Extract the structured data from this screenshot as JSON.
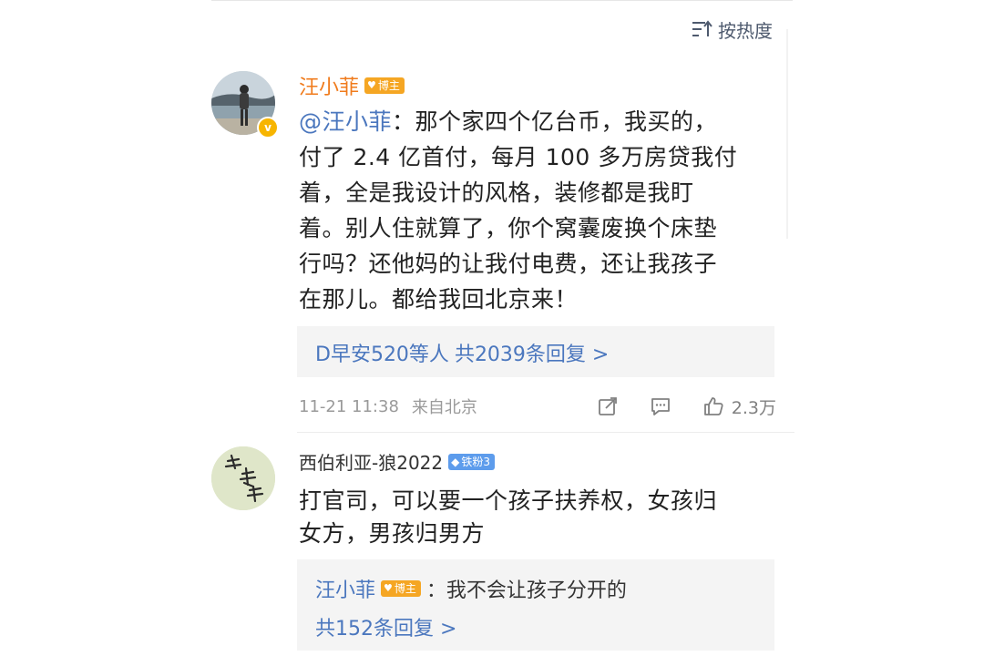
{
  "sort": {
    "icon": "sort-hot-icon",
    "label": "按热度"
  },
  "comment1": {
    "username": "汪小菲",
    "badge": "博主",
    "verified_mark": "v",
    "mention": "@汪小菲",
    "text_lines": [
      "：那个家四个亿台币，我买的，",
      "付了 2.4 亿首付，每月 100 多万房贷我付",
      "着，全是我设计的风格，装修都是我盯",
      "着。别人住就算了，你个窝囊废换个床垫",
      "行吗？还他妈的让我付电费，还让我孩子",
      "在那儿。都给我回北京来！"
    ],
    "replies_summary": {
      "who": "D早安520等人",
      "count_label": "共2039条回复 >"
    },
    "meta": {
      "timestamp": "11-21 11:38",
      "location": "来自北京",
      "likes": "2.3万"
    }
  },
  "comment2": {
    "username": "西伯利亚-狼2022",
    "badge": "铁粉3",
    "text_lines": [
      "打官司，可以要一个孩子扶养权，女孩归",
      "女方，男孩归男方"
    ],
    "reply": {
      "author": "汪小菲",
      "author_badge": "博主",
      "text": "：我不会让孩子分开的",
      "count_label": "共152条回复 >"
    }
  },
  "colors": {
    "brand_orange": "#f07b1c",
    "link_blue": "#4b77be",
    "badge_orange": "#f5a623",
    "badge_blue": "#5d9cec"
  }
}
